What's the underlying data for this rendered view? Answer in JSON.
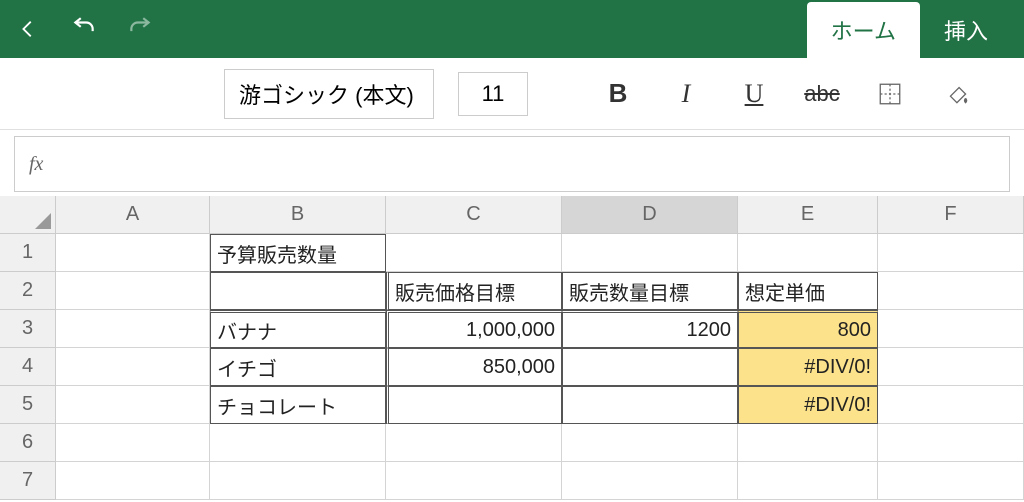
{
  "tabs": {
    "home": "ホーム",
    "insert": "挿入"
  },
  "ribbon": {
    "font_name": "游ゴシック (本文)",
    "font_size": "11",
    "bold_label": "B",
    "italic_label": "I",
    "underline_label": "U",
    "strike_label": "abc"
  },
  "formula": {
    "fx": "fx",
    "value": ""
  },
  "columns": [
    "A",
    "B",
    "C",
    "D",
    "E",
    "F"
  ],
  "selected_column": "D",
  "rows": [
    "1",
    "2",
    "3",
    "4",
    "5",
    "6",
    "7"
  ],
  "cells": {
    "B1": "予算販売数量",
    "C2": "販売価格目標",
    "D2": "販売数量目標",
    "E2": "想定単価",
    "B3": "バナナ",
    "C3": "1,000,000",
    "D3": "1200",
    "E3": "800",
    "B4": "イチゴ",
    "C4": "850,000",
    "E4": "#DIV/0!",
    "B5": "チョコレート",
    "E5": "#DIV/0!"
  }
}
